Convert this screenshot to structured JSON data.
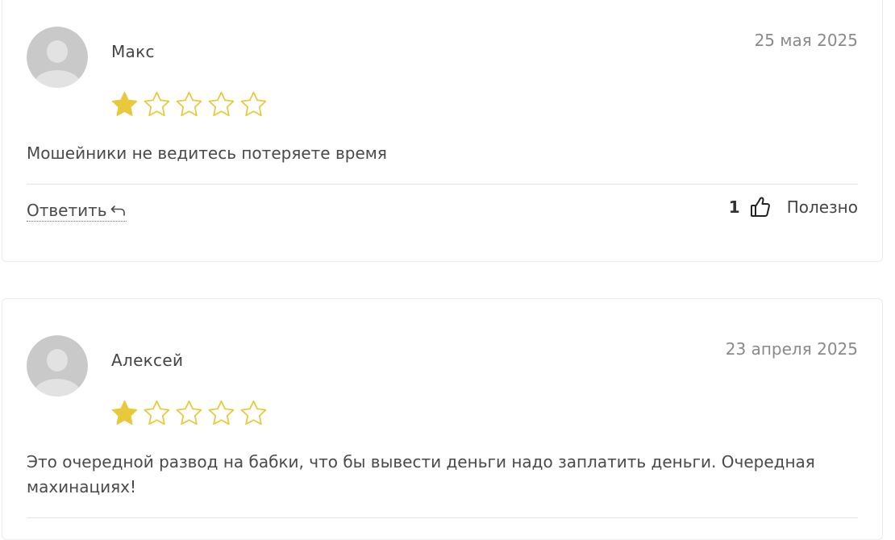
{
  "colors": {
    "star_filled": "#e8c93c",
    "star_outline": "#e8c93c",
    "avatar_bg": "#c9c9c9",
    "avatar_figure": "#e2e2e2",
    "divider": "#e5e5e5"
  },
  "reviews": [
    {
      "author": "Макс",
      "date": "25 мая 2025",
      "rating": 1,
      "max_rating": 5,
      "text": "Мошейники не ведитесь потеряете время",
      "reply_label": "Ответить",
      "likes": "1",
      "helpful_label": "Полезно",
      "icons": [
        "avatar-icon",
        "star-icon",
        "reply-arrow-icon",
        "thumbs-up-icon"
      ]
    },
    {
      "author": "Алексей",
      "date": "23 апреля 2025",
      "rating": 1,
      "max_rating": 5,
      "text": "Это очередной развод на бабки, что бы вывести деньги надо заплатить деньги. Очередная махинациях!",
      "icons": [
        "avatar-icon",
        "star-icon"
      ]
    }
  ]
}
